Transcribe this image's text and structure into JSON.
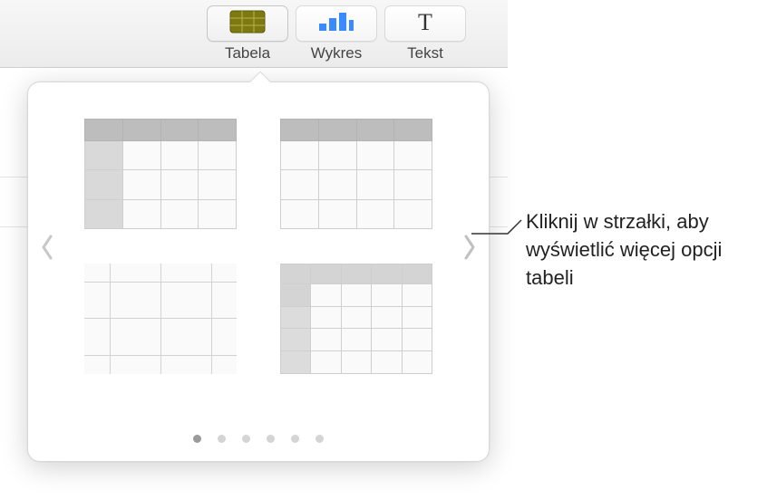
{
  "toolbar": {
    "table": {
      "label": "Tabela",
      "active": true
    },
    "chart": {
      "label": "Wykres",
      "active": false
    },
    "text": {
      "label": "Tekst",
      "active": false
    }
  },
  "popover": {
    "previews": [
      {
        "id": "table-style-1",
        "desc": "header-row-and-column"
      },
      {
        "id": "table-style-2",
        "desc": "header-row-only"
      },
      {
        "id": "table-style-3",
        "desc": "borderless"
      },
      {
        "id": "table-style-4",
        "desc": "header-row-col-light"
      }
    ],
    "page_count": 6,
    "active_page": 0,
    "nav": {
      "prev": "previous-styles",
      "next": "next-styles"
    }
  },
  "callout": {
    "text": "Kliknij w strzałki, aby wyświetlić więcej opcji tabeli"
  },
  "icons": {
    "table": "table-icon",
    "chart": "chart-icon",
    "text": "text-icon"
  },
  "colors": {
    "table_icon": "#6a6a0e",
    "chart_icon": "#1f76ff",
    "toolbar_bg": "#ececec"
  }
}
